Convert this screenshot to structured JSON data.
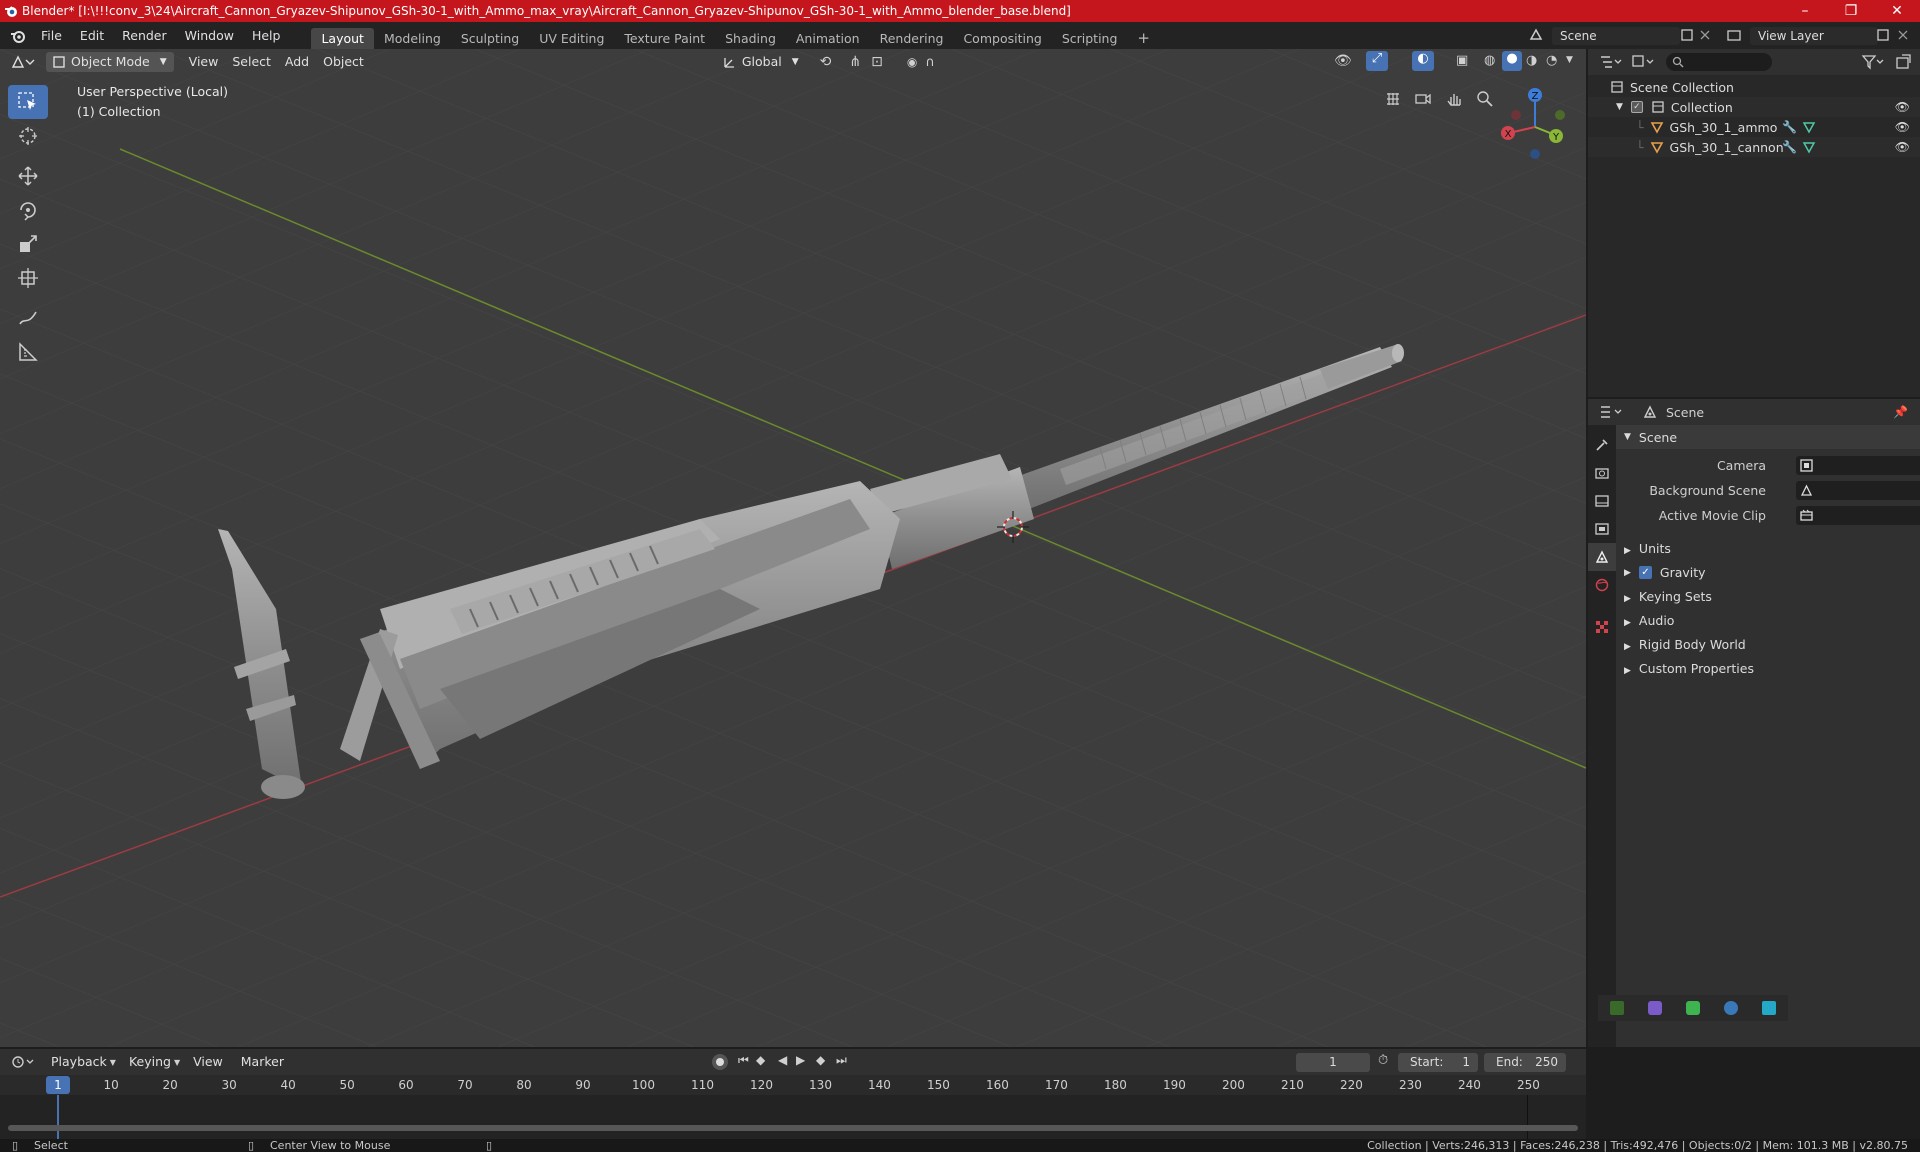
{
  "titlebar": {
    "title": "Blender* [I:\\!!!conv_3\\24\\Aircraft_Cannon_Gryazev-Shipunov_GSh-30-1_with_Ammo_max_vray\\Aircraft_Cannon_Gryazev-Shipunov_GSh-30-1_with_Ammo_blender_base.blend]",
    "minimize": "–",
    "maximize": "❐",
    "close": "✕"
  },
  "menu": [
    "File",
    "Edit",
    "Render",
    "Window",
    "Help"
  ],
  "workspaces": [
    "Layout",
    "Modeling",
    "Sculpting",
    "UV Editing",
    "Texture Paint",
    "Shading",
    "Animation",
    "Rendering",
    "Compositing",
    "Scripting"
  ],
  "workspace_add": "+",
  "scene": {
    "name": "Scene",
    "view_layer": "View Layer"
  },
  "viewport": {
    "mode": "Object Mode",
    "menus": [
      "View",
      "Select",
      "Add",
      "Object"
    ],
    "transform_orientation": "Global",
    "perspective_label": "User Perspective (Local)",
    "collection_label": "(1) Collection",
    "gizmo": {
      "x": "X",
      "y": "Y",
      "z": "Z"
    }
  },
  "outliner": {
    "search_placeholder": "",
    "scene_collection": "Scene Collection",
    "collection": "Collection",
    "objects": [
      "GSh_30_1_ammo",
      "GSh_30_1_cannon"
    ]
  },
  "properties": {
    "context": "Scene",
    "panel_title": "Scene",
    "fields": [
      {
        "label": "Camera"
      },
      {
        "label": "Background Scene"
      },
      {
        "label": "Active Movie Clip"
      }
    ],
    "panels": [
      "Units",
      "Gravity",
      "Keying Sets",
      "Audio",
      "Rigid Body World",
      "Custom Properties"
    ],
    "gravity_checked": true
  },
  "timeline": {
    "menus": [
      "Playback",
      "Keying",
      "View",
      "Marker"
    ],
    "current_frame": "1",
    "start_label": "Start:",
    "start": "1",
    "end_label": "End:",
    "end": "250",
    "ticks": [
      "1",
      "10",
      "20",
      "30",
      "40",
      "50",
      "60",
      "70",
      "80",
      "90",
      "100",
      "110",
      "120",
      "130",
      "140",
      "150",
      "160",
      "170",
      "180",
      "190",
      "200",
      "210",
      "220",
      "230",
      "240",
      "250"
    ]
  },
  "statusbar": {
    "select": "Select",
    "center_view": "Center View to Mouse",
    "stats": "Collection | Verts:246,313 | Faces:246,238 | Tris:492,476 | Objects:0/2 | Mem: 101.3 MB | v2.80.75"
  },
  "colors": {
    "title_bg": "#c4161c",
    "accent": "#4772b3",
    "axis_x": "#d2434e",
    "axis_y": "#8ab737",
    "axis_z": "#3d7dd9"
  }
}
